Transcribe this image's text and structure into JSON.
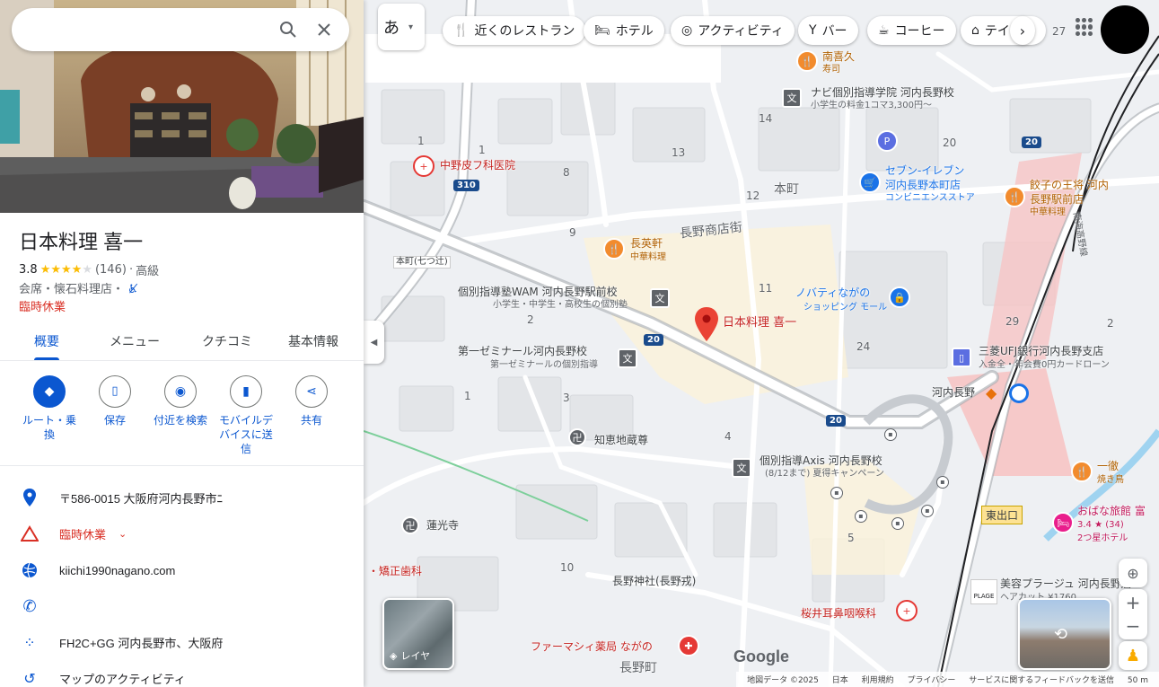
{
  "search": {
    "placeholder": "",
    "value": ""
  },
  "place": {
    "title": "日本料理 喜一",
    "rating": "3.8",
    "reviews": "(146)",
    "price": "高級",
    "category": "会席・懐石料理店・",
    "status": "臨時休業"
  },
  "tabs": [
    "概要",
    "メニュー",
    "クチコミ",
    "基本情報"
  ],
  "actions": [
    "ルート・乗換",
    "保存",
    "付近を検索",
    "モバイルデバイスに送信",
    "共有"
  ],
  "info": {
    "address": "〒586-0015 大阪府河内長野市ﾆ",
    "hours": "臨時休業",
    "website": "kiichi1990nagano.com",
    "phone": "",
    "plus_code": "FH2C+GG 河内長野市、大阪府",
    "activity": "マップのアクティビティ"
  },
  "chips": {
    "ime": "あ",
    "restaurants": "近くのレストラン",
    "hotels": "ホテル",
    "activities": "アクティビティ",
    "bars": "バー",
    "coffee": "コーヒー",
    "takeout": "テイ"
  },
  "map": {
    "selected": "日本料理 喜一",
    "labels": {
      "minamikikyu": "南喜久",
      "minamikikyu_sub": "寿司",
      "navi": "ナビ個別指導学院 河内長野校",
      "navi_sub": "小学生の料金1コマ3,300円〜",
      "nakano": "中野皮フ科医院",
      "seven": "セブン-イレブン",
      "seven2": "河内長野本町店",
      "seven_sub": "コンビニエンスストア",
      "gyoza": "餃子の王将 河内",
      "gyoza2": "長野駅前店",
      "gyoza_sub": "中華料理",
      "honmachi": "本町",
      "choeiken": "長英軒",
      "choeiken_sub": "中華料理",
      "shotengai": "長野商店街",
      "honmachi_cross": "本町(七つ辻)",
      "wam": "個別指導塾WAM 河内長野駅前校",
      "wam_sub": "小学生・中学生・高校生の個別塾",
      "novati": "ノバティながの",
      "novati_sub": "ショッピング モール",
      "daiichi": "第一ゼミナール河内長野校",
      "daiichi_sub": "第一ゼミナールの個別指導",
      "mufg": "三菱UFJ銀行河内長野支店",
      "mufg_sub": "入金全・年会費0円カードローン",
      "station": "河内長野",
      "chiejizo": "知恵地蔵尊",
      "axis": "個別指導Axis 河内長野校",
      "axis_sub": "(8/12まで) 夏得キャンペーン",
      "ittetsu": "一徹",
      "ittetsu_sub": "焼き鳥",
      "higashi": "東出口",
      "obana": "おばな旅館 富",
      "obana_rating": "3.4 ★ (34)",
      "obana_sub": "2つ星ホテル",
      "renkoji": "蓮光寺",
      "yano": "・矯正歯科",
      "biyou": "美容プラージュ 河内長野店",
      "biyou_sub": "ヘアカット ¥1760",
      "nagano_jinja": "長野神社(長野戎)",
      "sakurai": "桜井耳鼻咽喉科",
      "pharmacy": "ファーマシィ薬局 ながの",
      "naganocho": "長野町",
      "nankai": "南海高野線",
      "plage": "PLAGE"
    },
    "block_numbers": [
      "27",
      "14",
      "13",
      "1",
      "1",
      "8",
      "12",
      "20",
      "9",
      "11",
      "2",
      "29",
      "2",
      "24",
      "1",
      "3",
      "4",
      "5",
      "10"
    ],
    "routes": [
      "310",
      "20",
      "20",
      "20",
      "20"
    ],
    "layer_label": "レイヤ",
    "google": "Google",
    "attribution": [
      "地図データ ©2025",
      "日本",
      "利用規約",
      "プライバシー",
      "サービスに関するフィードバックを送信",
      "50 m"
    ]
  },
  "colors": {
    "accent": "#0b57d0",
    "closed": "#d93025",
    "star": "#fbbc04",
    "pin": "#ea4335"
  }
}
